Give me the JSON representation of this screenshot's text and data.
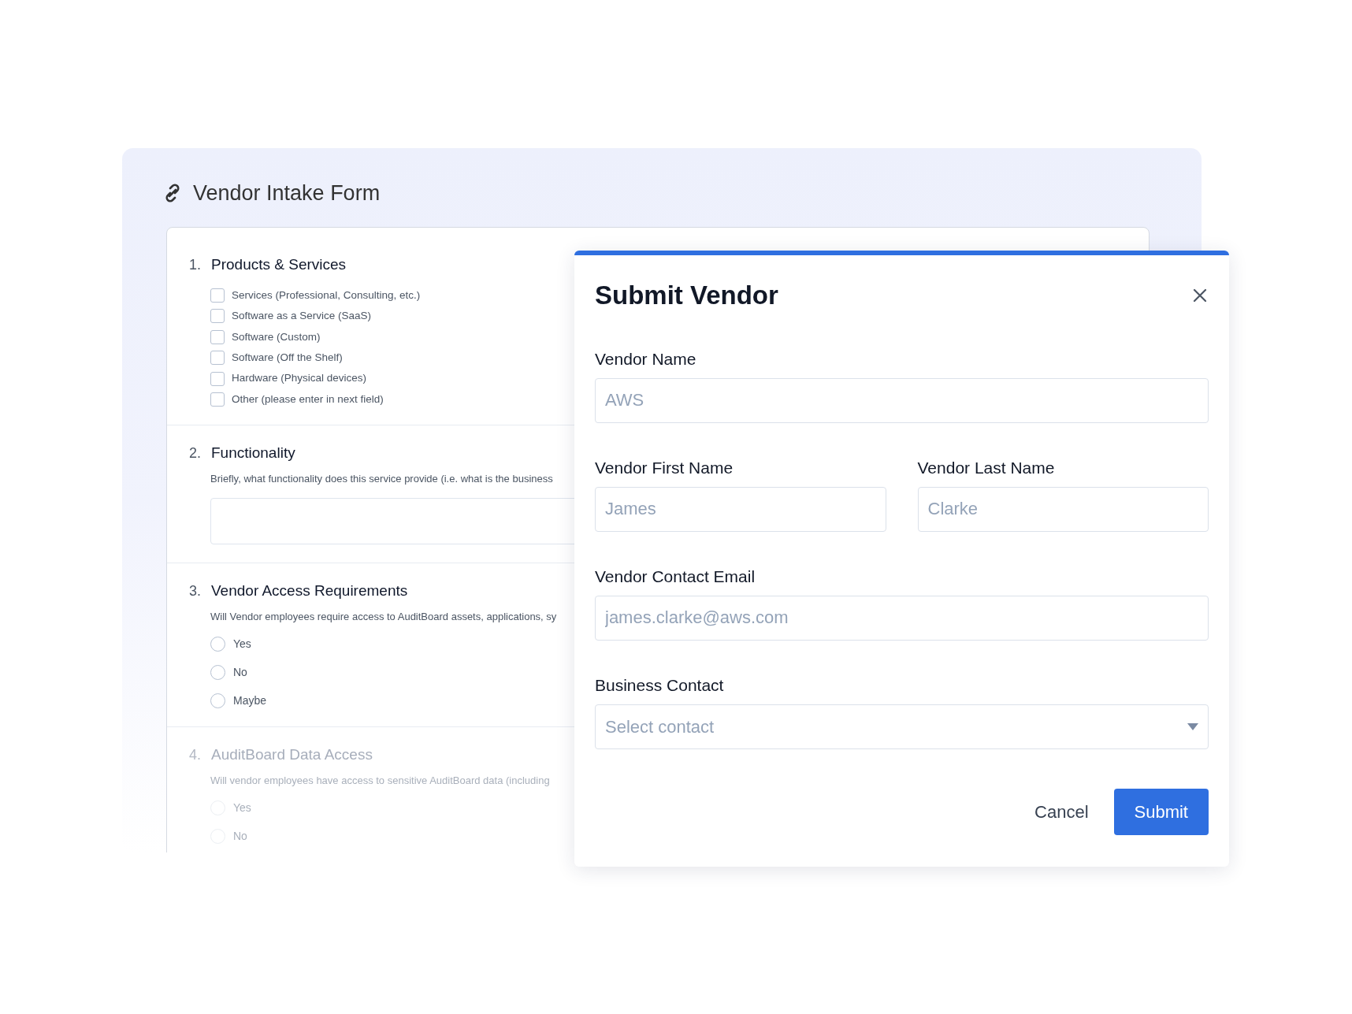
{
  "form": {
    "title": "Vendor Intake Form",
    "sections": [
      {
        "number": "1.",
        "title": "Products & Services",
        "kind": "checkboxes",
        "dimmed": false,
        "options": [
          {
            "label": "Services (Professional, Consulting, etc.)",
            "checked": false
          },
          {
            "label": "Software as a Service (SaaS)",
            "checked": false
          },
          {
            "label": "Software (Custom)",
            "checked": false
          },
          {
            "label": "Software (Off the Shelf)",
            "checked": false
          },
          {
            "label": "Hardware (Physical devices)",
            "checked": false
          },
          {
            "label": "Other (please enter in next field)",
            "checked": false
          }
        ]
      },
      {
        "number": "2.",
        "title": "Functionality",
        "kind": "textarea",
        "dimmed": false,
        "description": "Briefly, what functionality does this service provide (i.e. what is the business"
      },
      {
        "number": "3.",
        "title": "Vendor Access Requirements",
        "kind": "radios",
        "dimmed": false,
        "description": "Will Vendor employees require access to AuditBoard assets, applications, sy",
        "options": [
          {
            "label": "Yes",
            "selected": false
          },
          {
            "label": "No",
            "selected": false
          },
          {
            "label": "Maybe",
            "selected": false
          }
        ]
      },
      {
        "number": "4.",
        "title": "AuditBoard Data Access",
        "kind": "radios",
        "dimmed": true,
        "description": "Will vendor employees have access to sensitive AuditBoard data (including",
        "options": [
          {
            "label": "Yes",
            "selected": false
          },
          {
            "label": "No",
            "selected": false
          }
        ]
      }
    ]
  },
  "dialog": {
    "title": "Submit Vendor",
    "fields": [
      {
        "label": "Vendor Name",
        "placeholder": "AWS",
        "kind": "text"
      },
      {
        "label": "Vendor First Name",
        "placeholder": "James",
        "kind": "text"
      },
      {
        "label": "Vendor Last Name",
        "placeholder": "Clarke",
        "kind": "text"
      },
      {
        "label": "Vendor Contact Email",
        "placeholder": "james.clarke@aws.com",
        "kind": "text"
      },
      {
        "label": "Business Contact",
        "placeholder": "Select contact",
        "kind": "select"
      }
    ],
    "buttons": [
      {
        "label": "Cancel",
        "kind": "secondary"
      },
      {
        "label": "Submit",
        "kind": "primary"
      }
    ]
  }
}
